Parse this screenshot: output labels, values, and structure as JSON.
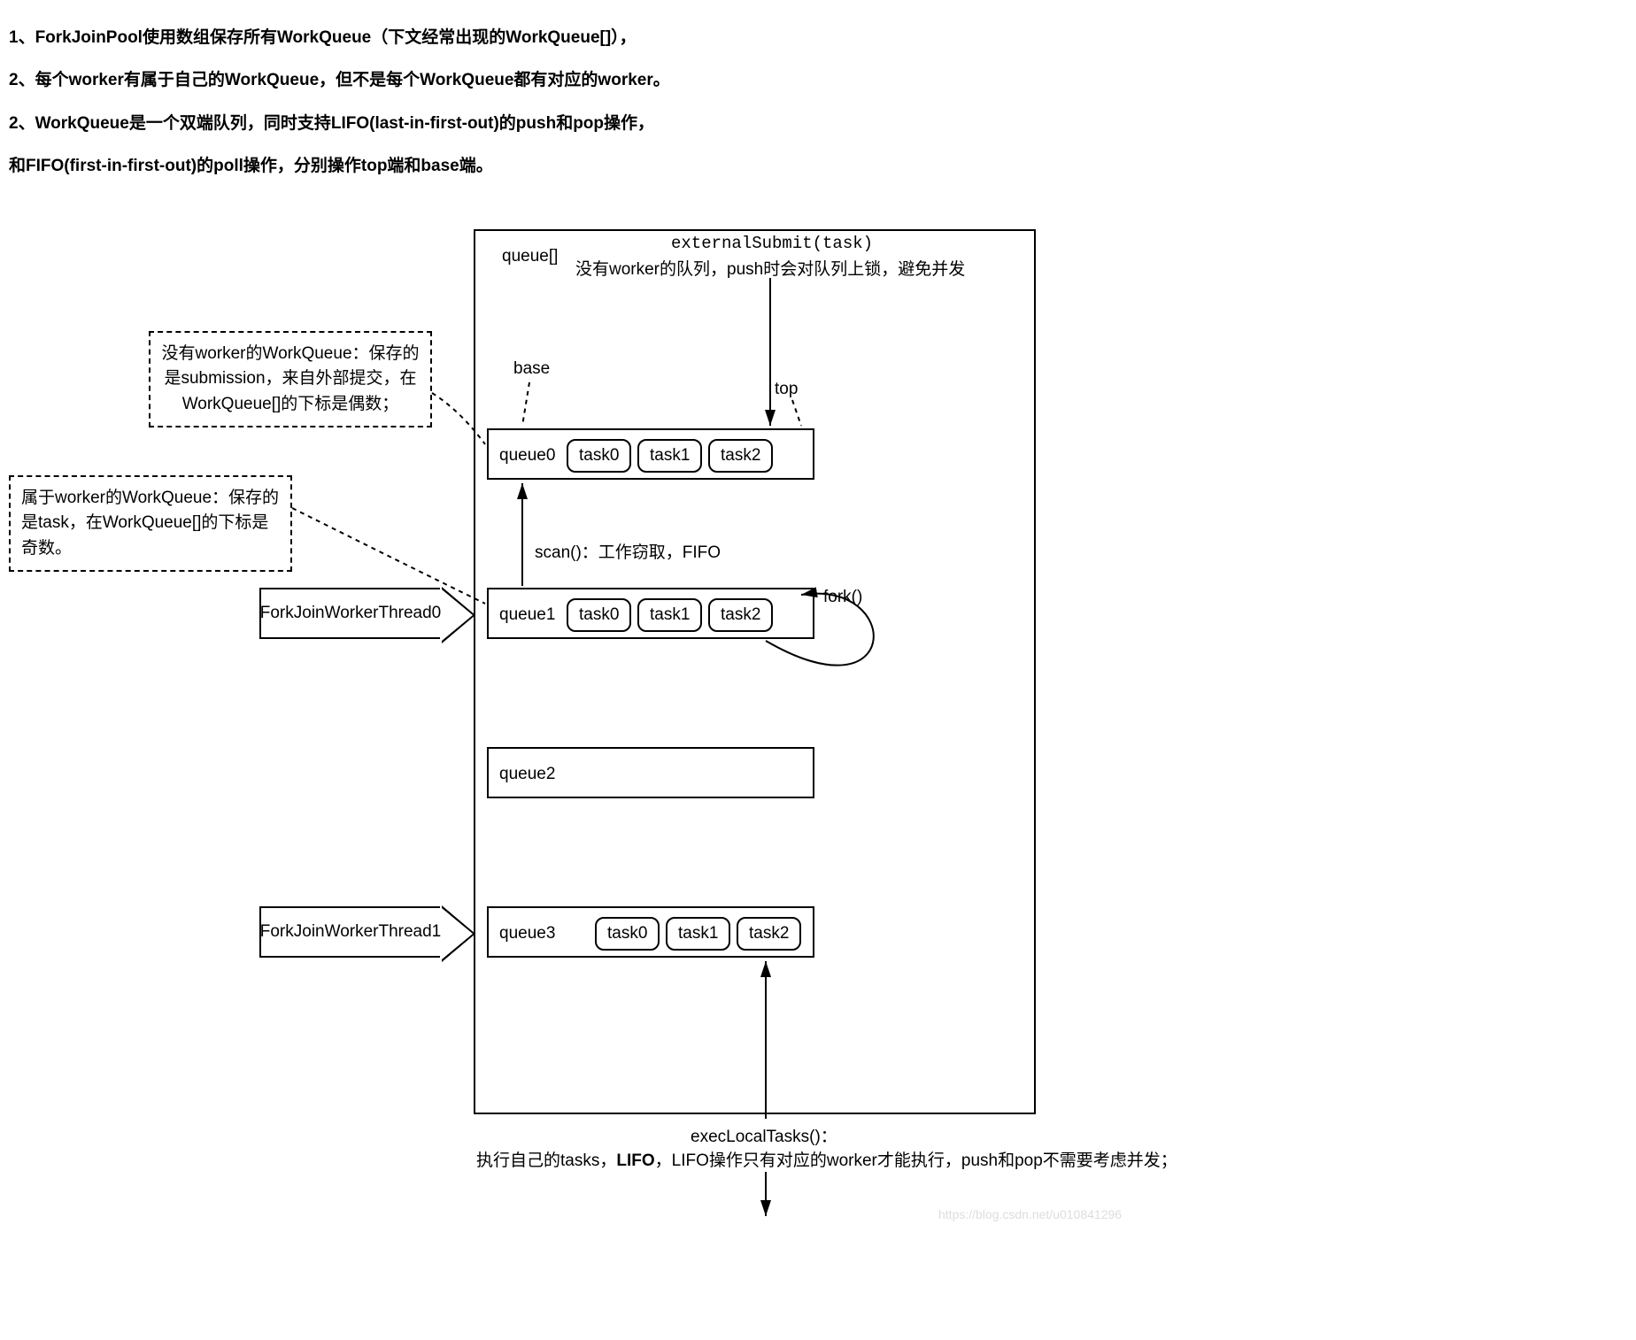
{
  "intro": {
    "line1": "1、ForkJoinPool使用数组保存所有WorkQueue（下文经常出现的WorkQueue[]），",
    "line2": "2、每个worker有属于自己的WorkQueue，但不是每个WorkQueue都有对应的worker。",
    "line3": "2、WorkQueue是一个双端队列，同时支持LIFO(last-in-first-out)的push和pop操作，",
    "line4": "和FIFO(first-in-first-out)的poll操作，分别操作top端和base端。"
  },
  "top_label": "queue[]",
  "external_submit": {
    "method": "externalSubmit(task)",
    "desc": "没有worker的队列，push时会对队列上锁，避免并发"
  },
  "pointer_labels": {
    "base": "base",
    "top": "top"
  },
  "notes": {
    "even": "没有worker的WorkQueue：保存的是submission，来自外部提交，在WorkQueue[]的下标是偶数；",
    "odd": "属于worker的WorkQueue：保存的是task，在WorkQueue[]的下标是奇数。"
  },
  "scan_label": "scan()：工作窃取，FIFO",
  "fork_label": "fork()",
  "threads": {
    "t0": "ForkJoinWorkerThread0",
    "t1": "ForkJoinWorkerThread1"
  },
  "queues": {
    "q0": {
      "name": "queue0",
      "tasks": [
        "task0",
        "task1",
        "task2"
      ]
    },
    "q1": {
      "name": "queue1",
      "tasks": [
        "task0",
        "task1",
        "task2"
      ]
    },
    "q2": {
      "name": "queue2",
      "tasks": []
    },
    "q3": {
      "name": "queue3",
      "tasks": [
        "task0",
        "task1",
        "task2"
      ]
    }
  },
  "exec_local": {
    "method": "execLocalTasks()：",
    "desc": "执行自己的tasks，LIFO，LIFO操作只有对应的worker才能执行，push和pop不需要考虑并发；"
  },
  "watermark": "https://blog.csdn.net/u010841296"
}
